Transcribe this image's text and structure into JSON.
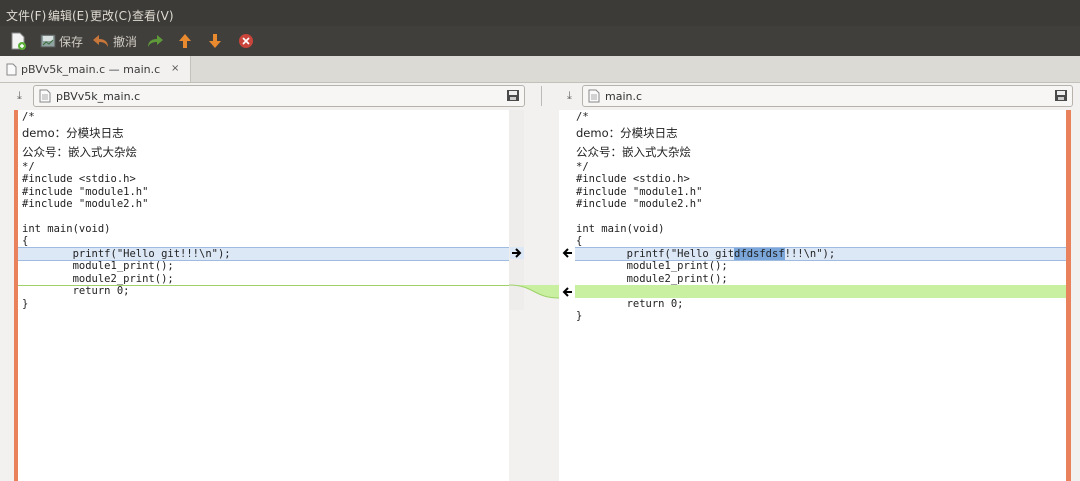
{
  "menu": [
    "文件(F)",
    "编辑(E)",
    "更改(C)",
    "查看(V)"
  ],
  "toolbar": {
    "new": "new-comparison-icon",
    "save_label": "保存",
    "undo_label": "撤消",
    "redo": "redo-icon",
    "prev": "previous-change-icon",
    "next": "next-change-icon",
    "stop": "stop-icon"
  },
  "tab": {
    "label": "pBVv5k_main.c — main.c",
    "close": "×"
  },
  "left": {
    "file": "pBVv5k_main.c",
    "lines": [
      "/*",
      "demo：分模块日志",
      "公众号：嵌入式大杂烩",
      "*/",
      "#include <stdio.h>",
      "#include \"module1.h\"",
      "#include \"module2.h\"",
      "",
      "int main(void)",
      "{",
      "        printf(\"Hello git!!!\\n\");",
      "        module1_print();",
      "        module2_print();",
      "        return 0;",
      "}"
    ]
  },
  "right": {
    "file": "main.c",
    "lines": [
      "/*",
      "demo：分模块日志",
      "公众号：嵌入式大杂烩",
      "*/",
      "#include <stdio.h>",
      "#include \"module1.h\"",
      "#include \"module2.h\"",
      "",
      "int main(void)",
      "{",
      "        printf(\"Hello git",
      "dfdsfdsf",
      "!!!\\n\");",
      "        module1_print();",
      "        module2_print();",
      "",
      "        return 0;",
      "}"
    ]
  },
  "colors": {
    "changed": "#dde8f7",
    "inserted": "#c8f0a0",
    "gutter": "#e9815d"
  }
}
